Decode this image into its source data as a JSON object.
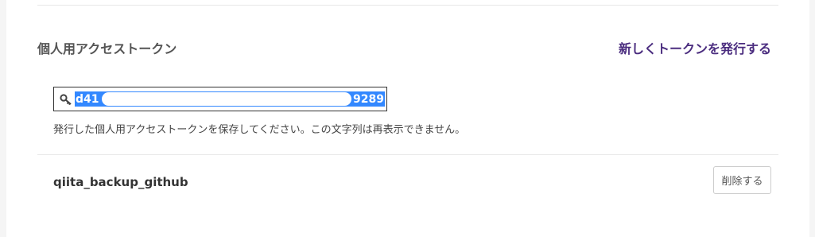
{
  "section": {
    "title": "個人用アクセストークン",
    "new_token_link": "新しくトークンを発行する"
  },
  "token": {
    "prefix": "d41",
    "suffix": "9289",
    "icon": "key-icon",
    "selection_color": "#3388ff"
  },
  "notice": "発行した個人用アクセストークンを保存してください。この文字列は再表示できません。",
  "token_entry": {
    "name": "qiita_backup_github",
    "delete_label": "削除する"
  },
  "colors": {
    "link": "#4b2d7f",
    "page_background": "#f5f5f5"
  }
}
